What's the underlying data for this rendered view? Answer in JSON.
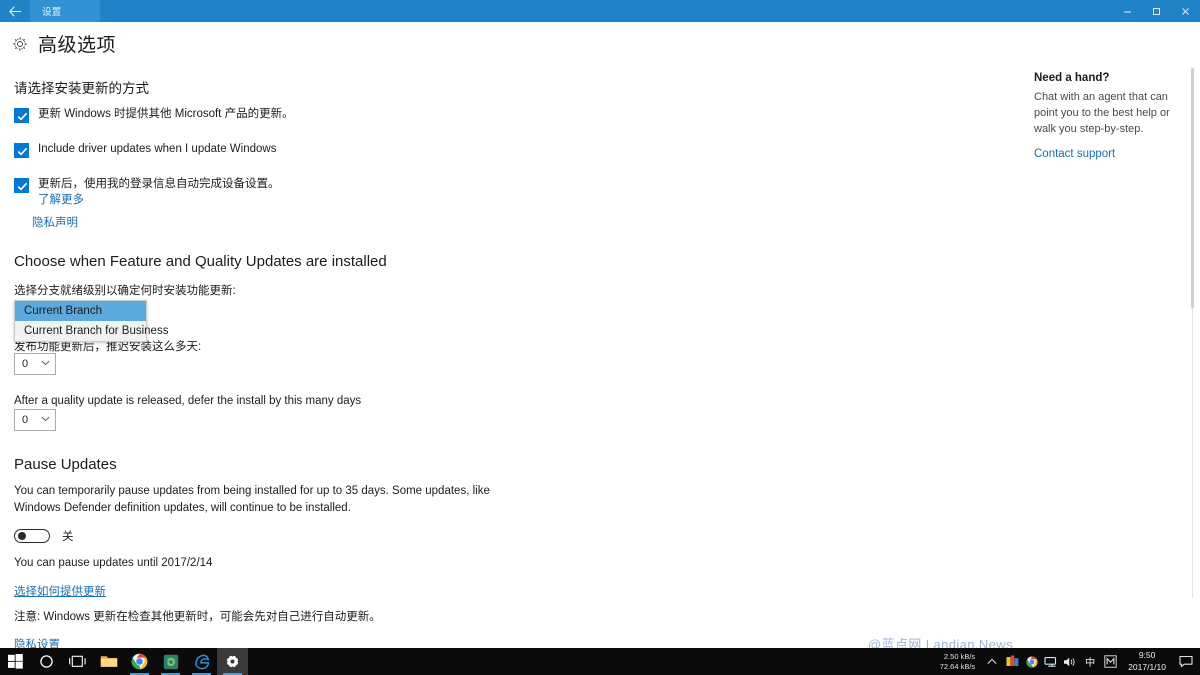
{
  "titlebar": {
    "back_icon": "back-arrow-icon",
    "tab_label": "设置",
    "minimize_label": "–",
    "restore_label": "❐",
    "close_label": "✕"
  },
  "header": {
    "icon": "gear-icon",
    "title": "高级选项"
  },
  "install_section": {
    "heading": "请选择安装更新的方式",
    "checkboxes": [
      {
        "label": "更新 Windows 时提供其他 Microsoft 产品的更新。",
        "checked": true
      },
      {
        "label": "Include driver updates when I update Windows",
        "checked": true
      },
      {
        "label": "更新后，使用我的登录信息自动完成设备设置。",
        "checked": true
      }
    ],
    "learn_more": "了解更多",
    "privacy_statement": "隐私声明"
  },
  "branch_section": {
    "heading": "Choose when Feature and Quality Updates are installed",
    "branch_label": "选择分支就绪级别以确定何时安装功能更新:",
    "dropdown_open": true,
    "options": [
      "Current Branch",
      "Current Branch for Business"
    ],
    "selected_option": "Current Branch",
    "feature_defer_label": "发布功能更新后，推迟安装这么多天:",
    "feature_defer_value": "0",
    "quality_defer_label": "After a quality update is released, defer the install by this many days",
    "quality_defer_value": "0",
    "chevron": "⌄"
  },
  "pause_section": {
    "heading": "Pause Updates",
    "description": "You can temporarily pause updates from being installed for up to 35 days. Some updates, like Windows Defender definition updates, will continue to be installed.",
    "toggle_state": "关",
    "toggle_on": false,
    "pause_until": "You can pause updates until 2017/2/14",
    "delivery_link": "选择如何提供更新",
    "note": "注意: Windows 更新在检查其他更新时，可能会先对自己进行自动更新。",
    "privacy_settings_link": "隐私设置"
  },
  "help_panel": {
    "title": "Need a hand?",
    "body": "Chat with an agent that can point you to the best help or walk you step-by-step.",
    "contact_link": "Contact support"
  },
  "watermark": "@蓝点网 Landian.News",
  "taskbar": {
    "items": [
      {
        "name": "start-button",
        "icon": "windows-logo-icon"
      },
      {
        "name": "cortana-button",
        "icon": "circle-icon"
      },
      {
        "name": "task-view-button",
        "icon": "task-view-icon"
      },
      {
        "name": "file-explorer-button",
        "icon": "folder-icon"
      },
      {
        "name": "chrome-button",
        "icon": "chrome-icon"
      },
      {
        "name": "evernote-button",
        "icon": "evernote-icon"
      },
      {
        "name": "edge-button",
        "icon": "edge-icon"
      },
      {
        "name": "settings-button",
        "icon": "gear-icon"
      }
    ],
    "network_down": "2.50 kB/s",
    "network_up": "72.64 kB/s",
    "tray_chevron": "⌃",
    "ime_label": "中",
    "ime_mode": "M",
    "time": "9:50",
    "date": "2017/1/10"
  },
  "colors": {
    "titlebar": "#2083c8",
    "accent": "#0078d7",
    "link": "#1a6fb5",
    "highlight": "#5ca9dd",
    "taskbar": "#0a0a0a"
  }
}
